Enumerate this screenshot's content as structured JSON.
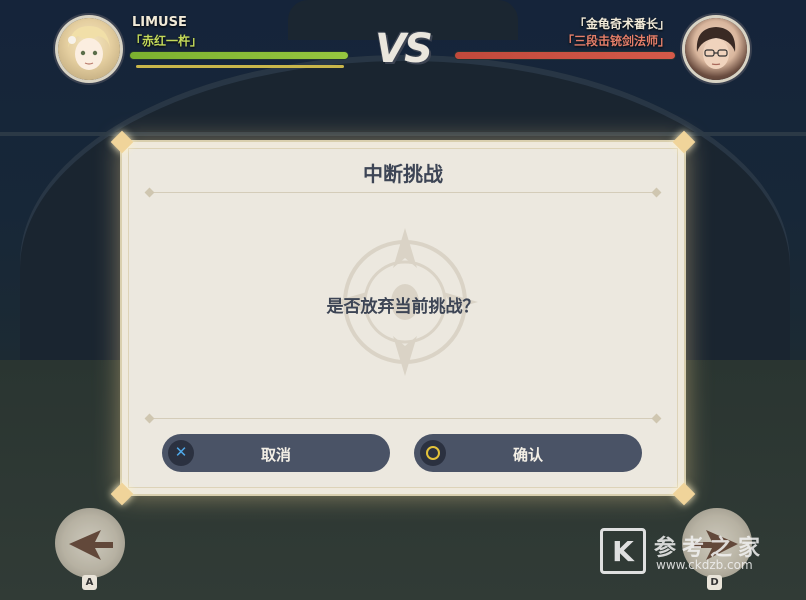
{
  "player": {
    "name": "LIMUSE",
    "title": "「赤红一杵」"
  },
  "opponent": {
    "title_line1": "「金龟奇术番长」",
    "title_line2": "「三段击铳剑法师」"
  },
  "vs_label": "VS",
  "dialog": {
    "title": "中断挑战",
    "message": "是否放弃当前挑战？",
    "cancel_label": "取消",
    "cancel_glyph": "✕",
    "confirm_label": "确认"
  },
  "controls": {
    "left_key": "A",
    "right_key": "D"
  },
  "watermark": {
    "logo_letter": "K",
    "site_name": "参考之家",
    "url": "www.ckdzb.com"
  },
  "colors": {
    "player_hp": "#96c63f",
    "opponent_hp": "#d45a49",
    "button": "#4a5366"
  }
}
